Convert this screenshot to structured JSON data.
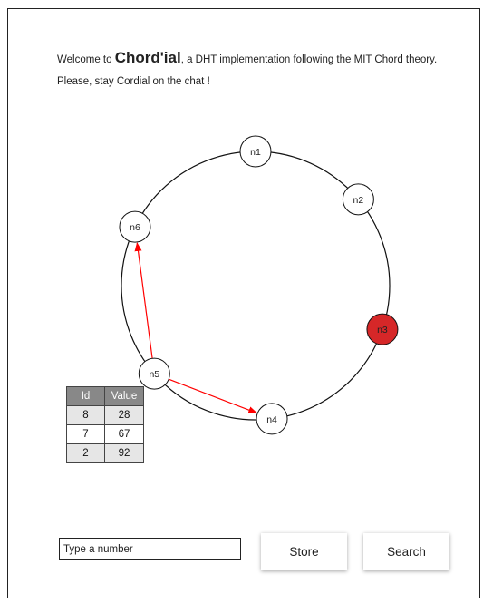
{
  "intro": {
    "welcome_prefix": "Welcome to ",
    "brand": "Chord'ial",
    "welcome_suffix": ", a DHT implementation following the MIT Chord theory.",
    "line2": "Please, stay Cordial on the chat !"
  },
  "ring": {
    "nodes": [
      {
        "label": "n1",
        "angle_deg": 0,
        "active": false
      },
      {
        "label": "n2",
        "angle_deg": 50,
        "active": false
      },
      {
        "label": "n3",
        "angle_deg": 109,
        "active": true
      },
      {
        "label": "n4",
        "angle_deg": 173,
        "active": false
      },
      {
        "label": "n5",
        "angle_deg": 229,
        "active": false
      },
      {
        "label": "n6",
        "angle_deg": 296,
        "active": false
      }
    ],
    "arrows": [
      {
        "from": "n5",
        "to": "n6"
      },
      {
        "from": "n5",
        "to": "n4"
      }
    ],
    "colors": {
      "active_node": "#d62728",
      "arrow": "#ff0000",
      "ring": "#111111"
    }
  },
  "table": {
    "headers": [
      "Id",
      "Value"
    ],
    "rows": [
      [
        "8",
        "28"
      ],
      [
        "7",
        "67"
      ],
      [
        "2",
        "92"
      ]
    ]
  },
  "controls": {
    "input_placeholder": "Type a number",
    "store_label": "Store",
    "search_label": "Search"
  }
}
